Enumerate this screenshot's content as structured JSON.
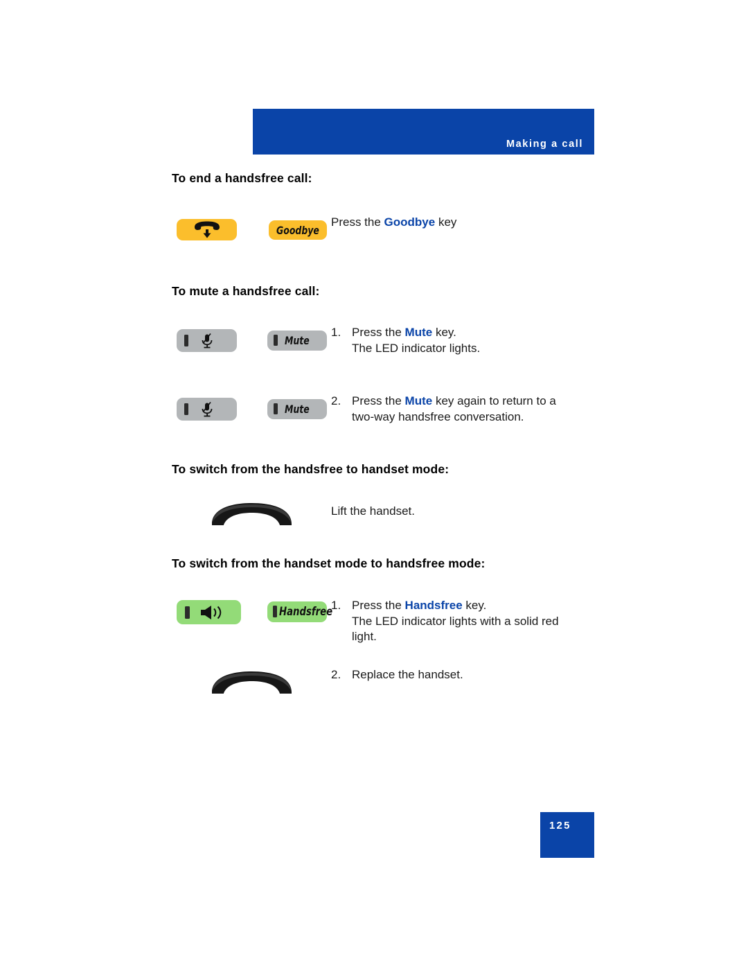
{
  "document": {
    "header": {
      "chapter_title": "Making a call",
      "band_color": "#0A44A8"
    },
    "page_footer": {
      "page_number": "125",
      "box_color": "#0A44A8"
    },
    "accent_color": "#0A44A8",
    "key_colors": {
      "goodbye": "#FBBE2C",
      "mute": "#B3B6B8",
      "handsfree": "#93DB78"
    },
    "sections": [
      {
        "id": "end-handsfree-call",
        "heading": "To end a handsfree call:",
        "steps": [
          {
            "number": "",
            "icon_key": "goodbye-phone-down-icon",
            "key_label": "Goodbye",
            "text_before": "Press the ",
            "text_highlight": "Goodbye",
            "text_after": " key",
            "line2": ""
          }
        ]
      },
      {
        "id": "mute-handsfree-call",
        "heading": "To mute a handsfree call:",
        "steps": [
          {
            "number": "1.",
            "icon_key": "mute-microphone-icon",
            "key_label": "Mute",
            "text_before": "Press the ",
            "text_highlight": "Mute",
            "text_after": " key.",
            "line2": "The LED indicator lights."
          },
          {
            "number": "2.",
            "icon_key": "mute-microphone-icon",
            "key_label": "Mute",
            "text_before": "Press the ",
            "text_highlight": "Mute",
            "text_after": " key again to return to a",
            "line2": "two-way handsfree conversation."
          }
        ]
      },
      {
        "id": "handsfree-to-handset",
        "heading": "To switch from the handsfree to handset mode:",
        "steps": [
          {
            "number": "",
            "icon_key": "handset-icon",
            "key_label": "",
            "text_before": "Lift the handset.",
            "text_highlight": "",
            "text_after": "",
            "line2": ""
          }
        ]
      },
      {
        "id": "handset-to-handsfree",
        "heading": "To switch from the handset mode to handsfree mode:",
        "steps": [
          {
            "number": "1.",
            "icon_key": "handsfree-speaker-icon",
            "key_label": "Handsfree",
            "text_before": "Press the ",
            "text_highlight": "Handsfree",
            "text_after": " key.",
            "line2": "The LED indicator lights with a solid red",
            "line3": "light."
          },
          {
            "number": "2.",
            "icon_key": "handset-icon",
            "key_label": "",
            "text_before": "Replace the handset.",
            "text_highlight": "",
            "text_after": "",
            "line2": ""
          }
        ]
      }
    ]
  }
}
